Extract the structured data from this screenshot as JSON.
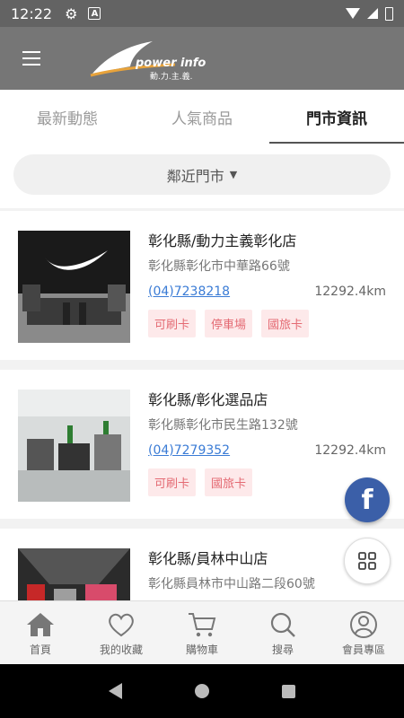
{
  "status_bar": {
    "time": "12:22",
    "a_icon": "A"
  },
  "app_bar": {
    "logo_text": "power info",
    "logo_subtext": "動.力.主.義."
  },
  "tabs": [
    {
      "label": "最新動態",
      "active": false
    },
    {
      "label": "人氣商品",
      "active": false
    },
    {
      "label": "門市資訊",
      "active": true
    }
  ],
  "filter": {
    "label": "鄰近門市",
    "caret": "▼"
  },
  "stores": [
    {
      "name": "彰化縣/動力主義彰化店",
      "address": "彰化縣彰化市中華路66號",
      "phone": "(04)7238218",
      "distance": "12292.4km",
      "tags": [
        "可刷卡",
        "停車場",
        "國旅卡"
      ]
    },
    {
      "name": "彰化縣/彰化選品店",
      "address": "彰化縣彰化市民生路132號",
      "phone": "(04)7279352",
      "distance": "12292.4km",
      "tags": [
        "可刷卡",
        "國旅卡"
      ]
    },
    {
      "name": "彰化縣/員林中山店",
      "address": "彰化縣員林市中山路二段60號",
      "phone": "",
      "distance": "",
      "tags": []
    }
  ],
  "fab": {
    "facebook_label": "f"
  },
  "bottom_nav": [
    {
      "label": "首頁",
      "icon": "home-icon"
    },
    {
      "label": "我的收藏",
      "icon": "heart-icon"
    },
    {
      "label": "購物車",
      "icon": "cart-icon"
    },
    {
      "label": "搜尋",
      "icon": "search-icon"
    },
    {
      "label": "會員專區",
      "icon": "user-icon"
    }
  ],
  "colors": {
    "app_bar": "#767676",
    "tag_bg": "#fde9ea",
    "tag_text": "#e46a73",
    "link": "#3a7bd5",
    "facebook": "#3b5fa8"
  }
}
